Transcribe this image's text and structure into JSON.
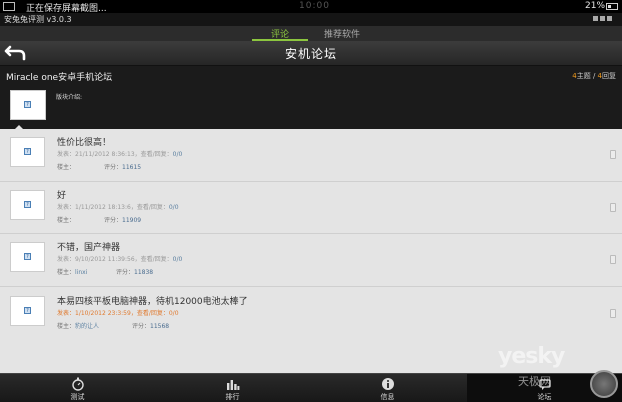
{
  "status_bar": {
    "notification": "正在保存屏幕截图...",
    "time": "10:00",
    "battery": "21%"
  },
  "app_bar": {
    "version": "安兔兔评测 v3.0.3"
  },
  "tabs": [
    {
      "label": "评论",
      "active": true
    },
    {
      "label": "推荐软件",
      "active": false
    }
  ],
  "header": {
    "title": "安机论坛"
  },
  "forum": {
    "name": "Miracle one安卓手机论坛",
    "topics_count": "4",
    "topics_label": "主题",
    "replies_count": "4",
    "replies_label": "回复",
    "intro_label": "版块介绍:"
  },
  "posts": [
    {
      "title": "性价比很高！",
      "posted_label": "发表：",
      "posted": "21/11/2012 8:36:13",
      "views_label": "，查看/回复：",
      "views": "0/0",
      "owner_label": "楼主：",
      "owner": "",
      "score_label": "评分：",
      "score": "11615"
    },
    {
      "title": "好",
      "posted_label": "发表：",
      "posted": "1/11/2012 18:13:6",
      "views_label": "，查看/回复：",
      "views": "0/0",
      "owner_label": "楼主：",
      "owner": "",
      "score_label": "评分：",
      "score": "11909"
    },
    {
      "title": "不错，国产神器",
      "posted_label": "发表：",
      "posted": "9/10/2012 11:39:56",
      "views_label": "，查看/回复：",
      "views": "0/0",
      "owner_label": "楼主：",
      "owner": "linxi",
      "score_label": "评分：",
      "score": "11838"
    },
    {
      "title": "本易四核平板电脑神器，待机12000电池太棒了",
      "posted_label": "发表：",
      "posted": "1/10/2012 23:3:59",
      "views_label": "，查看/回复：",
      "views": "0/0",
      "owner_label": "楼主：",
      "owner": "豹的让人",
      "score_label": "评分：",
      "score": "11568"
    }
  ],
  "bottom_nav": [
    {
      "label": "测试",
      "icon": "stopwatch-icon"
    },
    {
      "label": "排行",
      "icon": "bar-chart-icon"
    },
    {
      "label": "信息",
      "icon": "info-icon"
    },
    {
      "label": "论坛",
      "icon": "forum-icon",
      "active": true
    }
  ],
  "watermark": {
    "brand": "yesky",
    "sub": "天极网"
  },
  "colors": {
    "accent_green": "#8cc63f",
    "count_orange": "#f29b1d",
    "highlight_orange": "#e07a2f"
  }
}
